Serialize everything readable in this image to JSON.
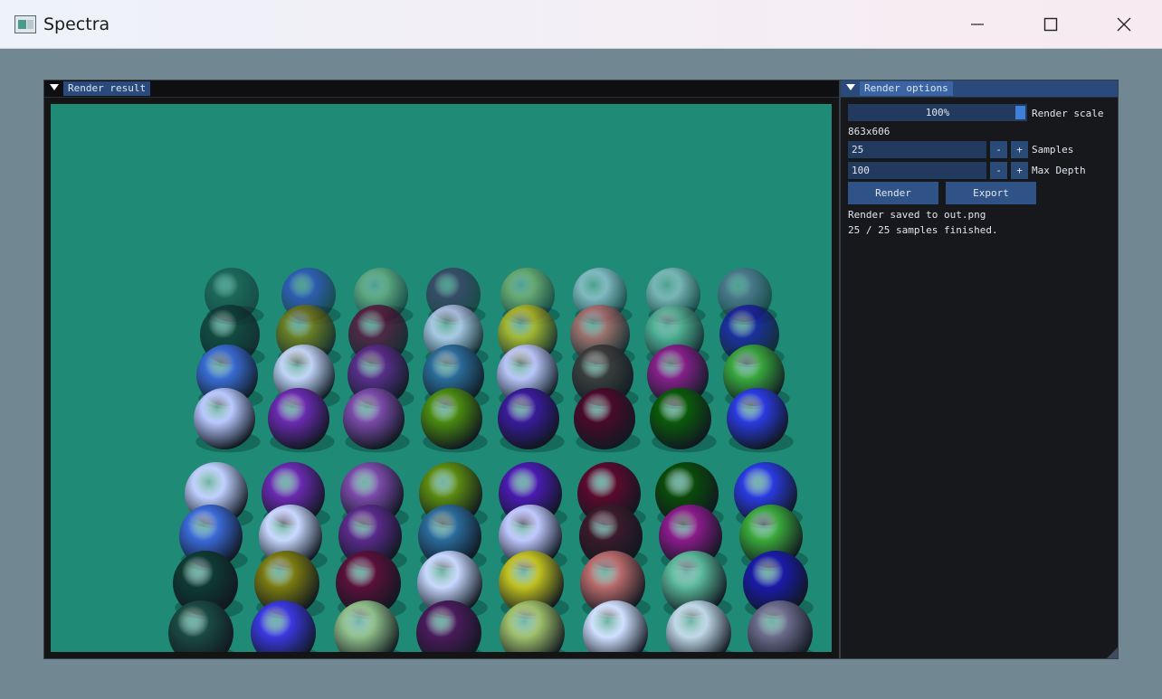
{
  "window": {
    "title": "Spectra"
  },
  "render_panel": {
    "tab_label": "Render result",
    "image_alt": "Path-traced grid of spheres"
  },
  "options_panel": {
    "tab_label": "Render options",
    "render_scale": {
      "value_text": "100%",
      "label": "Render scale",
      "fraction": 1.0
    },
    "resolution": "863x606",
    "samples": {
      "value": "25",
      "minus": "-",
      "plus": "+",
      "label": "Samples"
    },
    "max_depth": {
      "value": "100",
      "minus": "-",
      "plus": "+",
      "label": "Max Depth"
    },
    "render_button": "Render",
    "export_button": "Export",
    "status": [
      "Render saved to out.png",
      "25 / 25 samples finished."
    ]
  },
  "colors": {
    "background": "#1f8a76",
    "panel": "#16181c",
    "accent": "#3f7fd8"
  }
}
